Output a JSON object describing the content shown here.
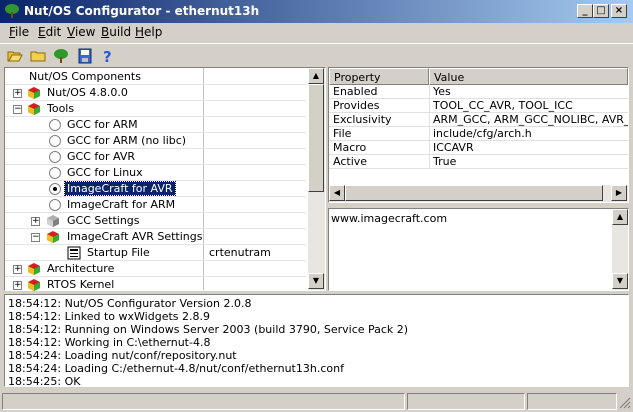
{
  "window": {
    "title": "Nut/OS Configurator - ethernut13h",
    "minimize_glyph": "_",
    "maximize_glyph": "□",
    "close_glyph": "×"
  },
  "menu": [
    {
      "label": "File",
      "mnemonic": "F",
      "rest": "ile"
    },
    {
      "label": "Edit",
      "mnemonic": "E",
      "rest": "dit"
    },
    {
      "label": "View",
      "mnemonic": "V",
      "rest": "iew"
    },
    {
      "label": "Build",
      "mnemonic": "B",
      "rest": "uild"
    },
    {
      "label": "Help",
      "mnemonic": "H",
      "rest": "elp"
    }
  ],
  "toolbar": {
    "icons": [
      "open-folder-icon",
      "new-folder-icon",
      "tree-icon",
      "save-icon",
      "help-icon"
    ]
  },
  "tree": {
    "header": "Nut/OS Components",
    "rows": [
      {
        "label": "Nut/OS 4.8.0.0",
        "kind": "cube",
        "expander": "+",
        "value": ""
      },
      {
        "label": "Tools",
        "kind": "cube",
        "expander": "−",
        "value": ""
      },
      {
        "label": "GCC for ARM",
        "kind": "radio",
        "value": ""
      },
      {
        "label": "GCC for ARM (no libc)",
        "kind": "radio",
        "value": ""
      },
      {
        "label": "GCC for AVR",
        "kind": "radio",
        "value": ""
      },
      {
        "label": "GCC for Linux",
        "kind": "radio",
        "value": ""
      },
      {
        "label": "ImageCraft for AVR",
        "kind": "radio",
        "checked": true,
        "selected": true,
        "value": ""
      },
      {
        "label": "ImageCraft for ARM",
        "kind": "radio",
        "value": ""
      },
      {
        "label": "GCC Settings",
        "kind": "graycube",
        "expander": "+",
        "value": ""
      },
      {
        "label": "ImageCraft AVR Settings",
        "kind": "cube",
        "expander": "−",
        "value": ""
      },
      {
        "label": "Startup File",
        "kind": "file",
        "value": "crtenutram"
      },
      {
        "label": "Architecture",
        "kind": "cube",
        "expander": "+",
        "value": ""
      },
      {
        "label": "RTOS Kernel",
        "kind": "cube",
        "expander": "+",
        "value": ""
      }
    ]
  },
  "properties": {
    "headers": [
      "Property",
      "Value"
    ],
    "rows": [
      {
        "property": "Enabled",
        "value": "Yes"
      },
      {
        "property": "Provides",
        "value": "TOOL_CC_AVR, TOOL_ICC"
      },
      {
        "property": "Exclusivity",
        "value": "ARM_GCC, ARM_GCC_NOLIBC, AVR_GC"
      },
      {
        "property": "File",
        "value": "include/cfg/arch.h"
      },
      {
        "property": "Macro",
        "value": "ICCAVR"
      },
      {
        "property": "Active",
        "value": "True"
      }
    ]
  },
  "description": {
    "text": "www.imagecraft.com"
  },
  "log": {
    "lines": [
      "18:54:12: Nut/OS Configurator Version 2.0.8",
      "18:54:12: Linked to wxWidgets 2.8.9",
      "18:54:12: Running on Windows Server 2003 (build 3790, Service Pack 2)",
      "18:54:12: Working in C:\\ethernut-4.8",
      "18:54:24: Loading nut/conf/repository.nut",
      "18:54:24: Loading C:/ethernut-4.8/nut/conf/ethernut13h.conf",
      "18:54:25: OK"
    ]
  },
  "colors": {
    "titlebar_start": "#0a246a",
    "titlebar_end": "#a6caf0",
    "selection": "#0a246a",
    "face": "#d4d0c8"
  }
}
